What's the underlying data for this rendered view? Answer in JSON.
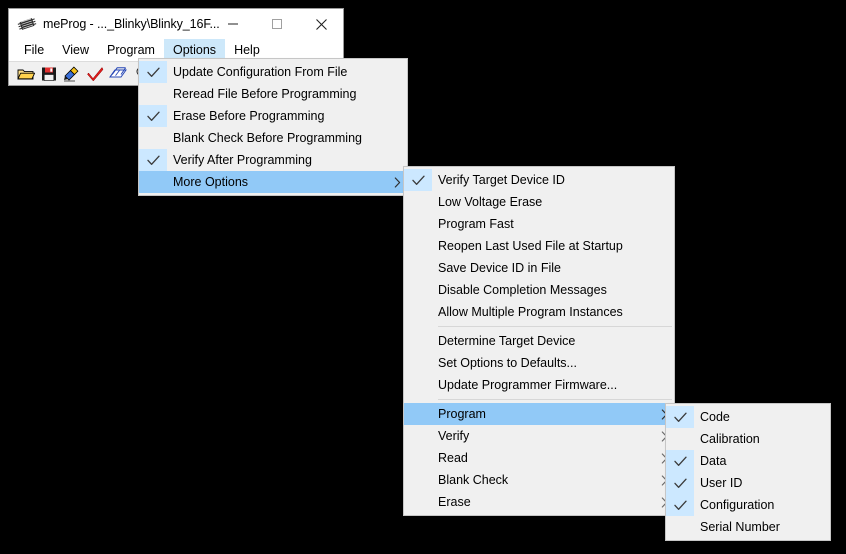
{
  "window": {
    "title": "meProg - ..._Blinky\\Blinky_16F...",
    "icon": "chip-icon",
    "controls": [
      {
        "name": "minimize-button",
        "glyph": "minimize-icon"
      },
      {
        "name": "maximize-button",
        "glyph": "maximize-icon"
      },
      {
        "name": "close-button",
        "glyph": "close-icon"
      }
    ]
  },
  "menubar": {
    "items": [
      {
        "label": "File",
        "active": false
      },
      {
        "label": "View",
        "active": false
      },
      {
        "label": "Program",
        "active": false
      },
      {
        "label": "Options",
        "active": true
      },
      {
        "label": "Help",
        "active": false
      }
    ]
  },
  "toolbar": {
    "icons": [
      {
        "name": "open-file-icon",
        "title": "Open File"
      },
      {
        "name": "save-file-icon",
        "title": "Save File"
      },
      {
        "name": "program-device-icon",
        "title": "Program Device"
      },
      {
        "name": "verify-icon",
        "title": "Verify"
      },
      {
        "name": "read-icon",
        "title": "Read"
      },
      {
        "name": "blank-check-icon",
        "title": "Blank Check"
      }
    ]
  },
  "options_menu": {
    "items": [
      {
        "label": "Update Configuration From File",
        "checked": true,
        "highlight": false,
        "submenu": false
      },
      {
        "label": "Reread File Before Programming",
        "checked": false,
        "highlight": false,
        "submenu": false
      },
      {
        "label": "Erase Before Programming",
        "checked": true,
        "highlight": false,
        "submenu": false
      },
      {
        "label": "Blank Check Before Programming",
        "checked": false,
        "highlight": false,
        "submenu": false
      },
      {
        "label": "Verify After Programming",
        "checked": true,
        "highlight": false,
        "submenu": false
      },
      {
        "label": "More Options",
        "checked": false,
        "highlight": true,
        "submenu": true
      }
    ]
  },
  "more_options_menu": {
    "items": [
      {
        "label": "Verify Target Device ID",
        "checked": true,
        "highlight": false,
        "submenu": false,
        "separator_after": false
      },
      {
        "label": "Low Voltage Erase",
        "checked": false,
        "highlight": false,
        "submenu": false,
        "separator_after": false
      },
      {
        "label": "Program Fast",
        "checked": false,
        "highlight": false,
        "submenu": false,
        "separator_after": false
      },
      {
        "label": "Reopen Last Used File at Startup",
        "checked": false,
        "highlight": false,
        "submenu": false,
        "separator_after": false
      },
      {
        "label": "Save Device ID in File",
        "checked": false,
        "highlight": false,
        "submenu": false,
        "separator_after": false
      },
      {
        "label": "Disable Completion Messages",
        "checked": false,
        "highlight": false,
        "submenu": false,
        "separator_after": false
      },
      {
        "label": "Allow Multiple Program Instances",
        "checked": false,
        "highlight": false,
        "submenu": false,
        "separator_after": true
      },
      {
        "label": "Determine Target Device",
        "checked": false,
        "highlight": false,
        "submenu": false,
        "separator_after": false
      },
      {
        "label": "Set Options to Defaults...",
        "checked": false,
        "highlight": false,
        "submenu": false,
        "separator_after": false
      },
      {
        "label": "Update Programmer Firmware...",
        "checked": false,
        "highlight": false,
        "submenu": false,
        "separator_after": true
      },
      {
        "label": "Program",
        "checked": false,
        "highlight": true,
        "submenu": true,
        "separator_after": false
      },
      {
        "label": "Verify",
        "checked": false,
        "highlight": false,
        "submenu": true,
        "separator_after": false
      },
      {
        "label": "Read",
        "checked": false,
        "highlight": false,
        "submenu": true,
        "separator_after": false
      },
      {
        "label": "Blank Check",
        "checked": false,
        "highlight": false,
        "submenu": true,
        "separator_after": false
      },
      {
        "label": "Erase",
        "checked": false,
        "highlight": false,
        "submenu": true,
        "separator_after": false
      }
    ]
  },
  "program_menu": {
    "items": [
      {
        "label": "Code",
        "checked": true,
        "highlight": false,
        "submenu": false
      },
      {
        "label": "Calibration",
        "checked": false,
        "highlight": false,
        "submenu": false
      },
      {
        "label": "Data",
        "checked": true,
        "highlight": false,
        "submenu": false
      },
      {
        "label": "User ID",
        "checked": true,
        "highlight": false,
        "submenu": false
      },
      {
        "label": "Configuration",
        "checked": true,
        "highlight": false,
        "submenu": false
      },
      {
        "label": "Serial Number",
        "checked": false,
        "highlight": false,
        "submenu": false
      }
    ]
  },
  "colors": {
    "menu_background": "#f0f0f0",
    "highlight": "#91c9f7",
    "check_background": "#cce8ff",
    "menubar_active": "#cde8fa",
    "desktop": "#000000",
    "toolbar_background": "#f0f0f0"
  }
}
